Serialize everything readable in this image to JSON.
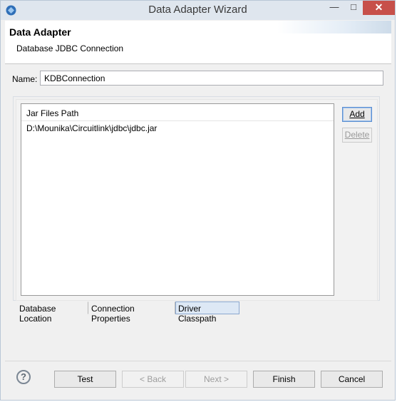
{
  "window": {
    "title": "Data Adapter Wizard",
    "controls": {
      "minimize": "—",
      "maximize": "□",
      "close": "✕"
    }
  },
  "header": {
    "title": "Data Adapter",
    "subtitle": "Database JDBC Connection"
  },
  "name_field": {
    "label": "Name:",
    "value": "KDBConnection"
  },
  "jar_table": {
    "column_header": "Jar Files Path",
    "rows": [
      "D:\\Mounika\\Circuitlink\\jdbc\\jdbc.jar"
    ]
  },
  "side_buttons": {
    "add": "Add",
    "delete": "Delete"
  },
  "tabs": [
    {
      "label": "Database Location"
    },
    {
      "label": "Connection Properties"
    },
    {
      "label": "Driver Classpath"
    }
  ],
  "footer": {
    "help_symbol": "?",
    "test": "Test",
    "back": "< Back",
    "next": "Next >",
    "finish": "Finish",
    "cancel": "Cancel"
  },
  "colors": {
    "titlebar": "#dfe6ee",
    "close_button": "#c7504a",
    "active_tab": "#dde8f5"
  }
}
